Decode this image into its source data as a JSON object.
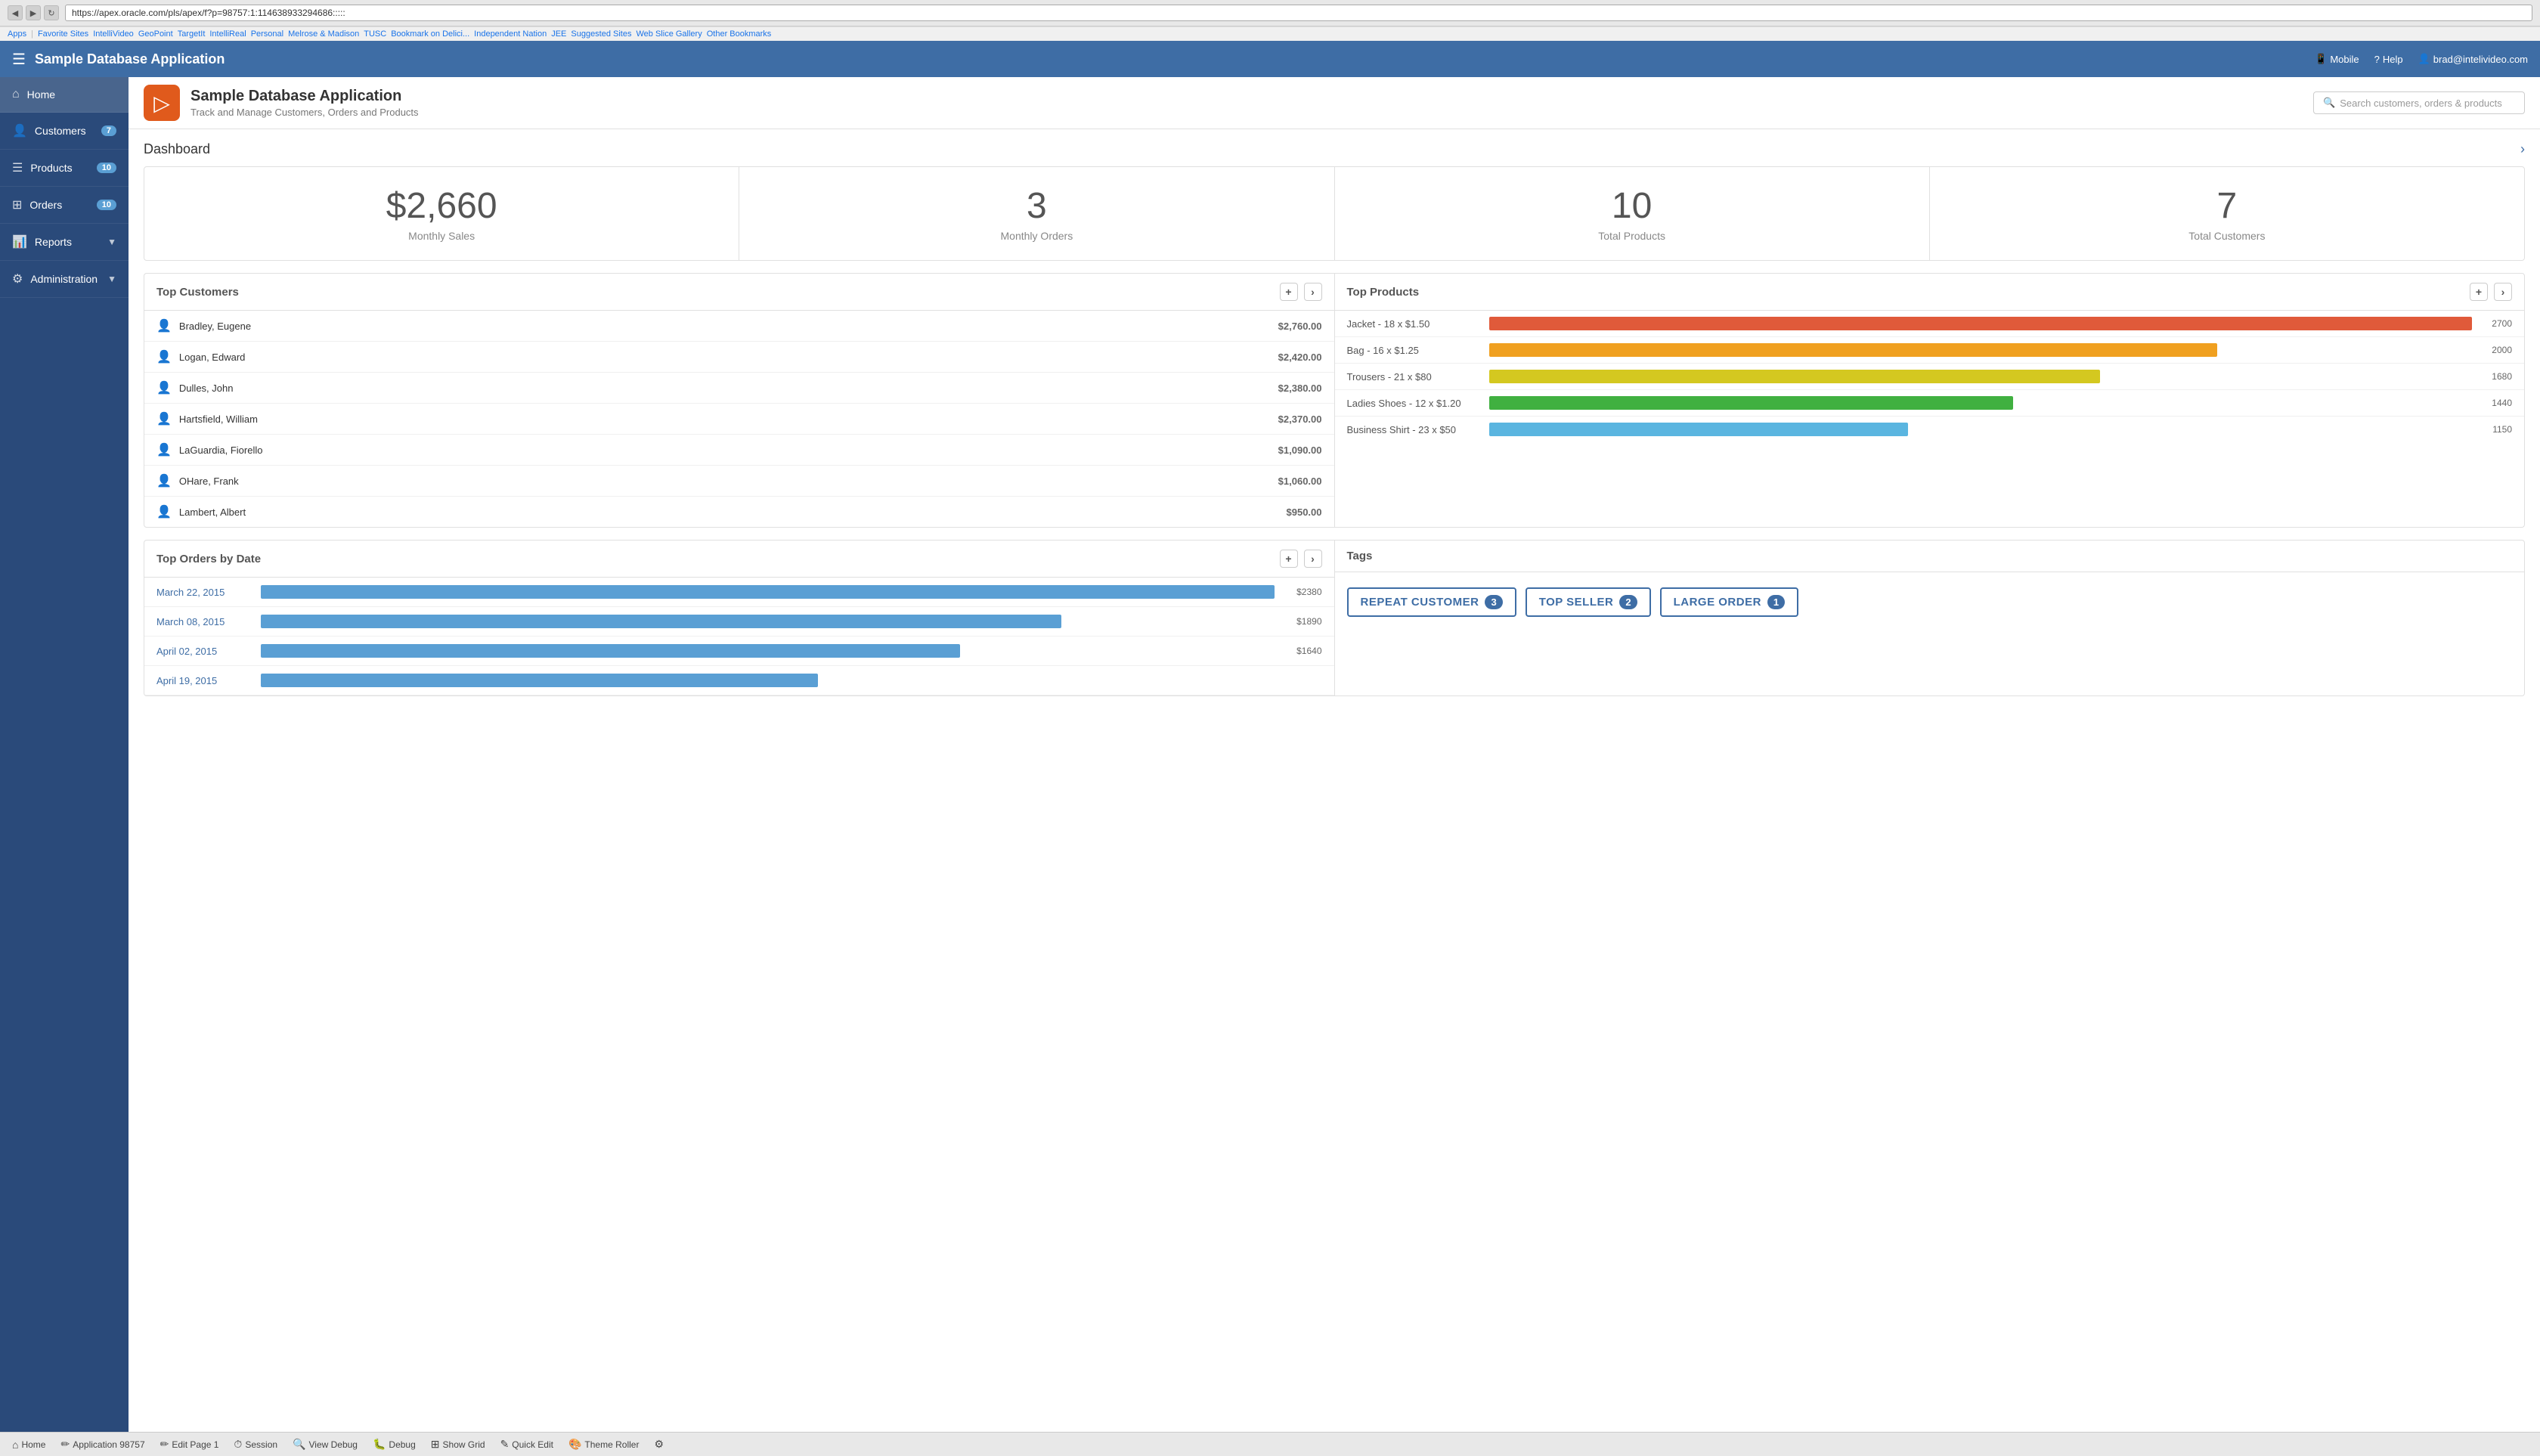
{
  "browser": {
    "url": "https://apex.oracle.com/pls/apex/f?p=98757:1:114638933294686:::::",
    "bookmarks": [
      "Apps",
      "Favorite Sites",
      "IntelliVideo",
      "GeoPoint",
      "TargetIt",
      "IntelliReal",
      "Personal",
      "Melrose & Madison",
      "TUSC",
      "Bookmark on Delici...",
      "Independent Nation",
      "JEE",
      "Suggested Sites",
      "Web Slice Gallery",
      "Other Bookmarks"
    ]
  },
  "appHeader": {
    "title": "Sample Database Application",
    "mobile": "Mobile",
    "help": "Help",
    "user": "brad@intelivideo.com"
  },
  "sidebar": {
    "items": [
      {
        "id": "home",
        "icon": "⌂",
        "label": "Home",
        "badge": null,
        "chevron": false
      },
      {
        "id": "customers",
        "icon": "👤",
        "label": "Customers",
        "badge": "7",
        "chevron": false
      },
      {
        "id": "products",
        "icon": "☰",
        "label": "Products",
        "badge": "10",
        "chevron": false
      },
      {
        "id": "orders",
        "icon": "⊞",
        "label": "Orders",
        "badge": "10",
        "chevron": false
      },
      {
        "id": "reports",
        "icon": "📊",
        "label": "Reports",
        "badge": null,
        "chevron": true
      },
      {
        "id": "administration",
        "icon": "⚙",
        "label": "Administration",
        "badge": null,
        "chevron": true
      }
    ]
  },
  "subHeader": {
    "title": "Sample Database Application",
    "subtitle": "Track and Manage Customers, Orders and Products",
    "search_placeholder": "Search customers, orders & products"
  },
  "dashboard": {
    "title": "Dashboard",
    "stats": [
      {
        "number": "$2,660",
        "label": "Monthly Sales"
      },
      {
        "number": "3",
        "label": "Monthly Orders"
      },
      {
        "number": "10",
        "label": "Total Products"
      },
      {
        "number": "7",
        "label": "Total Customers"
      }
    ]
  },
  "topCustomers": {
    "title": "Top Customers",
    "customers": [
      {
        "name": "Bradley, Eugene",
        "amount": "$2,760.00"
      },
      {
        "name": "Logan, Edward",
        "amount": "$2,420.00"
      },
      {
        "name": "Dulles, John",
        "amount": "$2,380.00"
      },
      {
        "name": "Hartsfield, William",
        "amount": "$2,370.00"
      },
      {
        "name": "LaGuardia, Fiorello",
        "amount": "$1,090.00"
      },
      {
        "name": "OHare, Frank",
        "amount": "$1,060.00"
      },
      {
        "name": "Lambert, Albert",
        "amount": "$950.00"
      }
    ]
  },
  "topProducts": {
    "title": "Top Products",
    "products": [
      {
        "name": "Jacket - 18 x $1.50",
        "value": 2700,
        "max": 2700,
        "color": "#e05a3a"
      },
      {
        "name": "Bag - 16 x $1.25",
        "value": 2000,
        "max": 2700,
        "color": "#f0a020"
      },
      {
        "name": "Trousers - 21 x $80",
        "value": 1680,
        "max": 2700,
        "color": "#d4c820"
      },
      {
        "name": "Ladies Shoes - 12 x $1.20",
        "value": 1440,
        "max": 2700,
        "color": "#40b040"
      },
      {
        "name": "Business Shirt - 23 x $50",
        "value": 1150,
        "max": 2700,
        "color": "#5ab5e0"
      }
    ]
  },
  "topOrders": {
    "title": "Top Orders by Date",
    "orders": [
      {
        "date": "March 22, 2015",
        "amount": "$2380",
        "pct": 100
      },
      {
        "date": "March 08, 2015",
        "amount": "$1890",
        "pct": 79
      },
      {
        "date": "April 02, 2015",
        "amount": "$1640",
        "pct": 69
      },
      {
        "date": "April 19, 2015",
        "amount": "",
        "pct": 55
      }
    ]
  },
  "tags": {
    "title": "Tags",
    "items": [
      {
        "label": "REPEAT CUSTOMER",
        "count": "3"
      },
      {
        "label": "TOP SELLER",
        "count": "2"
      },
      {
        "label": "LARGE ORDER",
        "count": "1"
      }
    ]
  },
  "bottomToolbar": {
    "items": [
      {
        "icon": "⌂",
        "label": "Home"
      },
      {
        "icon": "✏",
        "label": "Application 98757"
      },
      {
        "icon": "✏",
        "label": "Edit Page 1"
      },
      {
        "icon": "⏱",
        "label": "Session"
      },
      {
        "icon": "🔍",
        "label": "View Debug"
      },
      {
        "icon": "🐛",
        "label": "Debug"
      },
      {
        "icon": "⊞",
        "label": "Show Grid"
      },
      {
        "icon": "✎",
        "label": "Quick Edit"
      },
      {
        "icon": "🎨",
        "label": "Theme Roller"
      },
      {
        "icon": "⚙",
        "label": ""
      }
    ]
  }
}
